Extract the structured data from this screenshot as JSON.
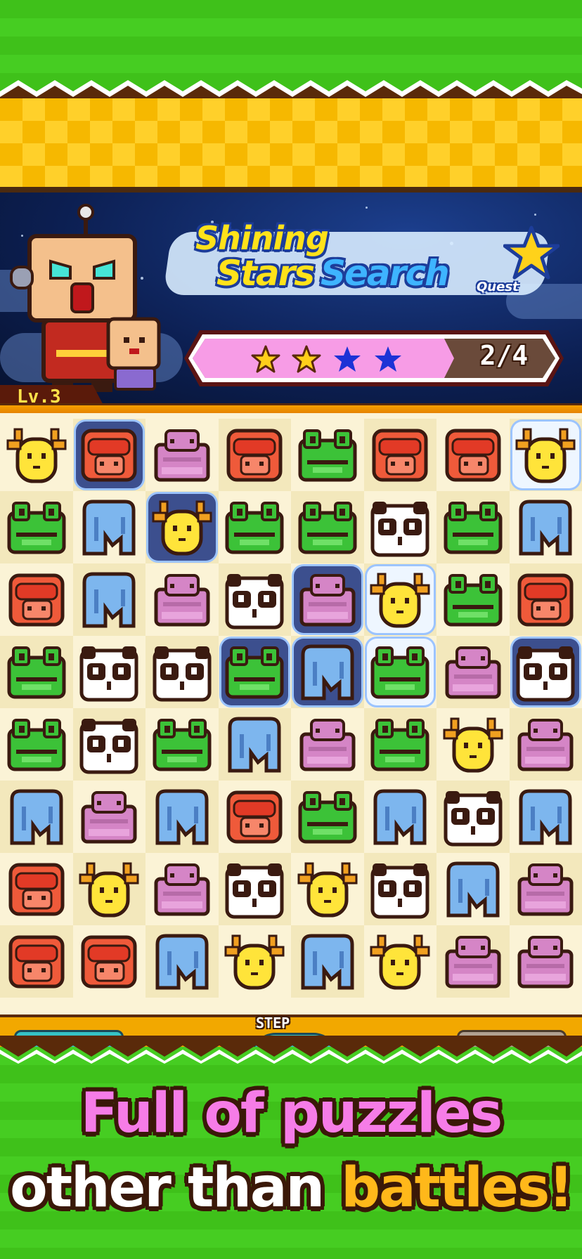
{
  "colors": {
    "green": "#3fc11a",
    "checker": "#f6b800",
    "progress_fill": "#f79ce6",
    "slogan_pink": "#f67ce7",
    "slogan_orange": "#ffb81a"
  },
  "header": {
    "title_line1": "Shining",
    "title_stars": "Stars",
    "title_search": "Search",
    "title_quest": "Quest"
  },
  "progress": {
    "stars_collected": 2,
    "stars_total": 4,
    "count_text": "2/4"
  },
  "player": {
    "level_text": "Lv.3"
  },
  "board": {
    "rows": [
      [
        "giraffe",
        "monkey",
        "hippo",
        "monkey",
        "frog",
        "monkey",
        "monkey",
        "giraffe"
      ],
      [
        "frog",
        "elephant",
        "giraffe",
        "frog",
        "frog",
        "panda",
        "frog",
        "elephant"
      ],
      [
        "monkey",
        "elephant",
        "hippo",
        "panda",
        "hippo",
        "giraffe",
        "frog",
        "monkey"
      ],
      [
        "frog",
        "panda",
        "panda",
        "frog",
        "elephant",
        "frog",
        "hippo",
        "panda"
      ],
      [
        "frog",
        "panda",
        "frog",
        "elephant",
        "hippo",
        "frog",
        "giraffe",
        "hippo"
      ],
      [
        "elephant",
        "hippo",
        "elephant",
        "monkey",
        "frog",
        "elephant",
        "panda",
        "elephant"
      ],
      [
        "monkey",
        "giraffe",
        "hippo",
        "panda",
        "giraffe",
        "panda",
        "elephant",
        "hippo"
      ],
      [
        "monkey",
        "monkey",
        "elephant",
        "giraffe",
        "elephant",
        "giraffe",
        "hippo",
        "hippo"
      ]
    ],
    "highlights": [
      {
        "r": 0,
        "c": 1,
        "style": "blue"
      },
      {
        "r": 0,
        "c": 7,
        "style": "white"
      },
      {
        "r": 1,
        "c": 2,
        "style": "blue"
      },
      {
        "r": 2,
        "c": 4,
        "style": "blue"
      },
      {
        "r": 2,
        "c": 5,
        "style": "white"
      },
      {
        "r": 3,
        "c": 3,
        "style": "blue"
      },
      {
        "r": 3,
        "c": 4,
        "style": "blue"
      },
      {
        "r": 3,
        "c": 5,
        "style": "white"
      },
      {
        "r": 3,
        "c": 7,
        "style": "blue"
      }
    ]
  },
  "controls": {
    "step_label": "STEP"
  },
  "slogan": {
    "line1": "Full of puzzles",
    "line2_plain": "other than ",
    "line2_accent": "battles!"
  }
}
